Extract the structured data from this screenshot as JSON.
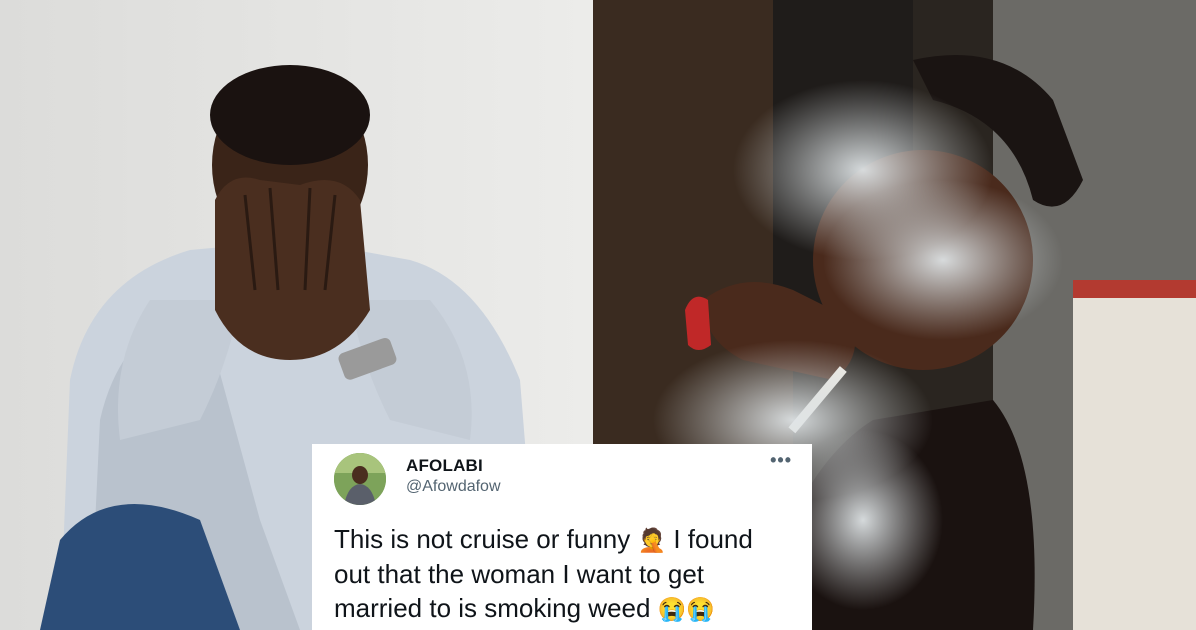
{
  "tweet": {
    "author_name": "AFOLABI",
    "author_handle": "@Afowdafow",
    "more_icon": "more-icon",
    "more_glyph": "•••",
    "text_line1": "This is not cruise or funny",
    "emoji_facepalm": "🤦",
    "text_line1_end": "I found",
    "text_line2": "out that the woman I want to get",
    "text_line3": "married to is smoking weed",
    "emoji_crying": "😭😭"
  },
  "colors": {
    "text_primary": "#0f1419",
    "text_secondary": "#536471",
    "card_background": "#ffffff"
  }
}
